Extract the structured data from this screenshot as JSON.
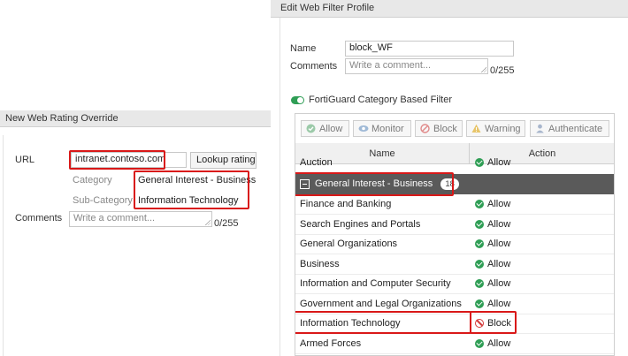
{
  "left_panel": {
    "title": "New Web Rating Override",
    "url_label": "URL",
    "url_value": "intranet.contoso.com",
    "lookup_button": "Lookup rating",
    "category_label": "Category",
    "category_value": "General Interest - Business",
    "subcategory_label": "Sub-Category",
    "subcategory_value": "Information Technology",
    "comments_label": "Comments",
    "comments_placeholder": "Write a comment...",
    "comments_counter": "0/255"
  },
  "right_panel": {
    "title": "Edit Web Filter Profile",
    "name_label": "Name",
    "name_value": "block_WF",
    "comments_label": "Comments",
    "comments_placeholder": "Write a comment...",
    "comments_counter": "0/255",
    "filter_toggle_label": "FortiGuard Category Based Filter",
    "toolbar": {
      "allow": "Allow",
      "monitor": "Monitor",
      "block": "Block",
      "warning": "Warning",
      "authenticate": "Authenticate"
    },
    "columns": {
      "name": "Name",
      "action": "Action"
    },
    "partial_row": {
      "name": "Auction",
      "action": "Allow"
    },
    "group": {
      "name": "General Interest - Business",
      "count": "18"
    },
    "rows": [
      {
        "name": "Finance and Banking",
        "action": "Allow",
        "status": "allow"
      },
      {
        "name": "Search Engines and Portals",
        "action": "Allow",
        "status": "allow"
      },
      {
        "name": "General Organizations",
        "action": "Allow",
        "status": "allow"
      },
      {
        "name": "Business",
        "action": "Allow",
        "status": "allow"
      },
      {
        "name": "Information and Computer Security",
        "action": "Allow",
        "status": "allow"
      },
      {
        "name": "Government and Legal Organizations",
        "action": "Allow",
        "status": "allow"
      },
      {
        "name": "Information Technology",
        "action": "Block",
        "status": "block"
      },
      {
        "name": "Armed Forces",
        "action": "Allow",
        "status": "allow"
      }
    ]
  },
  "colors": {
    "highlight": "#d91818",
    "allow": "#2f9e55",
    "block": "#d43a3a",
    "group_bg": "#5a5a5a"
  }
}
